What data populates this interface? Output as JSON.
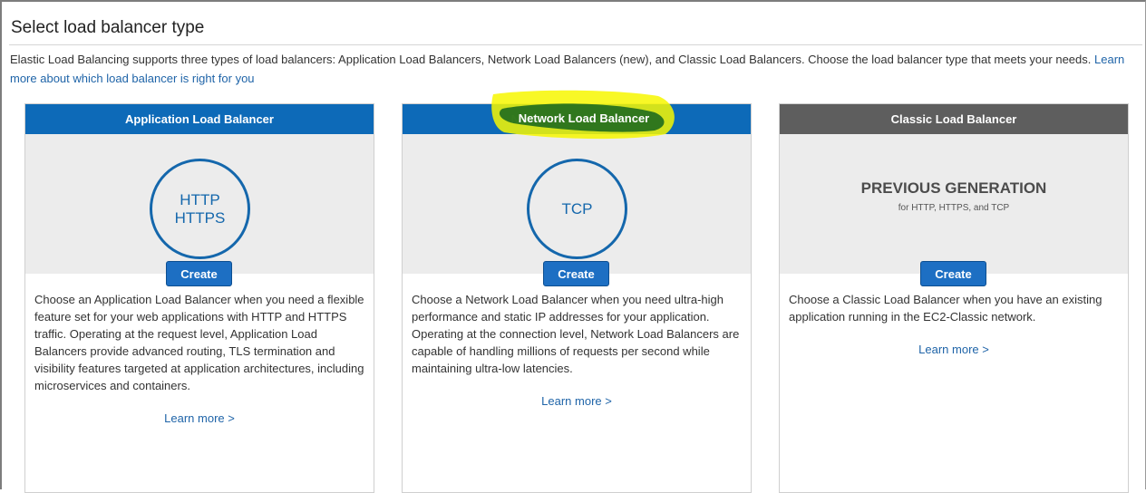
{
  "page": {
    "title": "Select load balancer type",
    "intro_text": "Elastic Load Balancing supports three types of load balancers: Application Load Balancers, Network Load Balancers (new), and Classic Load Balancers. Choose the load balancer type that meets your needs.",
    "intro_link": "Learn more about which load balancer is right for you"
  },
  "cards": [
    {
      "header": "Application Load Balancer",
      "protocols": [
        "HTTP",
        "HTTPS"
      ],
      "create_label": "Create",
      "description": "Choose an Application Load Balancer when you need a flexible feature set for your web applications with HTTP and HTTPS traffic. Operating at the request level, Application Load Balancers provide advanced routing, TLS termination and visibility features targeted at application architectures, including microservices and containers.",
      "learn_more": "Learn more >"
    },
    {
      "header": "Network Load Balancer",
      "protocols": [
        "TCP"
      ],
      "create_label": "Create",
      "description": "Choose a Network Load Balancer when you need ultra-high performance and static IP addresses for your application. Operating at the connection level, Network Load Balancers are capable of handling millions of requests per second while maintaining ultra-low latencies.",
      "learn_more": "Learn more >"
    },
    {
      "header": "Classic Load Balancer",
      "generation_title": "PREVIOUS GENERATION",
      "generation_subtitle": "for HTTP, HTTPS, and TCP",
      "create_label": "Create",
      "description": "Choose a Classic Load Balancer when you have an existing application running in the EC2-Classic network.",
      "learn_more": "Learn more >"
    }
  ],
  "colors": {
    "header_blue": "#0d6ab8",
    "header_gray": "#5e5e5e",
    "accent_blue": "#1467ac",
    "button_blue": "#1d6fc3",
    "highlighter_yellow": "#f7f700",
    "highlighter_green": "#1e6b1e"
  }
}
